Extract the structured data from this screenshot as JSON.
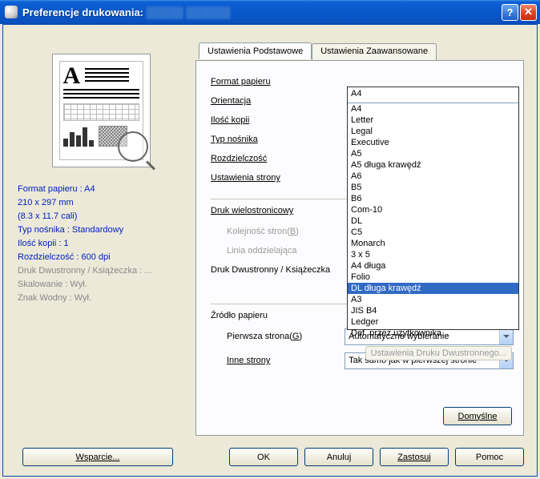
{
  "title": "Preferencje drukowania:",
  "title_redacted": "█████ ██████",
  "tabs": {
    "basic": "Ustawienia Podstawowe",
    "advanced": "Ustawienia Zaawansowane"
  },
  "labels": {
    "paper_format": "Format papieru",
    "orientation": "Orientacja",
    "copies": "Ilość kopii",
    "media_type": "Typ nośnika",
    "resolution": "Rozdzielczość",
    "page_setup": "Ustawienia strony",
    "multipage": "Druk wielostronicowy",
    "page_order_pre": "Kolejność stron(",
    "page_order_key": "B",
    "page_order_post": ")",
    "border_line": "Linia oddzielająca",
    "duplex": "Druk Dwustronny / Książeczka",
    "duplex_settings": "Ustawienia Druku Dwustronnego...",
    "paper_source": "Źródło papieru",
    "first_page_pre": "Pierwsza strona(",
    "first_page_key": "G",
    "first_page_post": ")",
    "other_pages": "Inne strony"
  },
  "paper_format_selected": "A4",
  "paper_format_options": [
    "A4",
    "Letter",
    "Legal",
    "Executive",
    "A5",
    "A5 długa krawędź",
    "A6",
    "B5",
    "B6",
    "Com-10",
    "DL",
    "C5",
    "Monarch",
    "3 x 5",
    "A4 długa",
    "Folio",
    "DL długa krawędź",
    "A3",
    "JIS B4",
    "Ledger",
    "Def. przez użytkownika..."
  ],
  "paper_format_highlighted_index": 16,
  "first_page_value": "Automatyczne wybieranie",
  "other_pages_value": "Tak samo jak w pierwszej stronie",
  "sidebar_info": {
    "paper": "Format papieru : A4",
    "dim_mm": "210 x 297 mm",
    "dim_in": "(8.3 x 11.7 cali)",
    "media": "Typ nośnika : Standardowy",
    "copies": "Ilość kopii : 1",
    "resolution": "Rozdzielczość : 600 dpi",
    "duplex": "Druk Dwustronny / Książeczka : ...",
    "scaling": "Skalowanie : Wył.",
    "watermark": "Znak Wodny : Wył."
  },
  "buttons": {
    "defaults": "Domyślne",
    "support": "Wsparcie...",
    "ok": "OK",
    "cancel": "Anuluj",
    "apply": "Zastosuj",
    "help": "Pomoc"
  }
}
